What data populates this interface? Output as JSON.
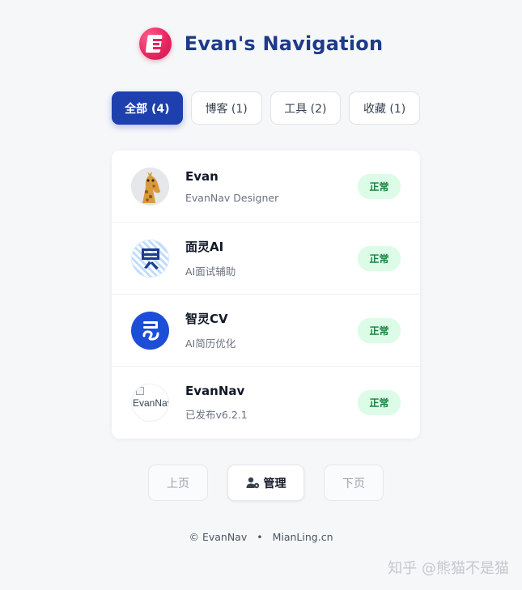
{
  "header": {
    "logo_icon": "e-logo-icon",
    "title": "Evan's Navigation",
    "accent": "#1e3a8a"
  },
  "tabs": [
    {
      "label": "全部 (4)",
      "active": true
    },
    {
      "label": "博客 (1)",
      "active": false
    },
    {
      "label": "工具 (2)",
      "active": false
    },
    {
      "label": "收藏 (1)",
      "active": false
    }
  ],
  "items": [
    {
      "name": "Evan",
      "desc": "EvanNav Designer",
      "status": "正常",
      "avatar": "giraffe-avatar-icon"
    },
    {
      "name": "面灵AI",
      "desc": "AI面试辅助",
      "status": "正常",
      "avatar": "mianling-logo-icon"
    },
    {
      "name": "智灵CV",
      "desc": "AI简历优化",
      "status": "正常",
      "avatar": "zhiling-logo-icon"
    },
    {
      "name": "EvanNav",
      "desc": "已发布v6.2.1",
      "status": "正常",
      "avatar": "broken-image-icon",
      "alt": "EvanNav"
    }
  ],
  "pager": {
    "prev": "上页",
    "manage": "管理",
    "next": "下页"
  },
  "footer": {
    "left": "© EvanNav",
    "sep": "•",
    "right": "MianLing.cn"
  },
  "watermark": "知乎 @熊猫不是猫",
  "colors": {
    "primary": "#1e40af",
    "badge_bg": "#dcfce7",
    "badge_text": "#15803d",
    "logo": "#e2255d"
  }
}
